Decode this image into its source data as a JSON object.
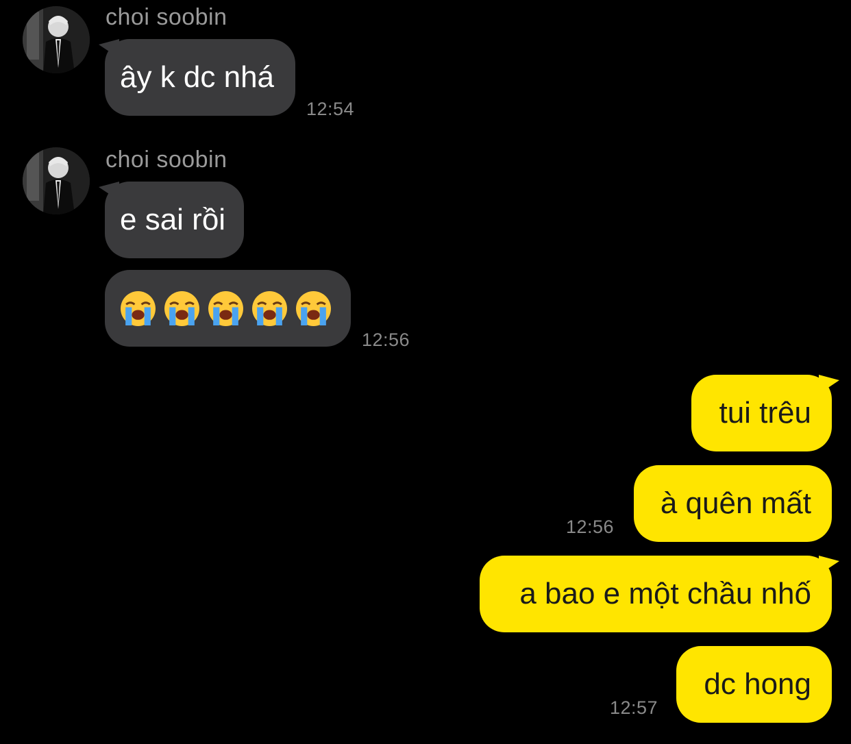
{
  "colors": {
    "background": "#000000",
    "incoming_bubble": "#3a3a3c",
    "outgoing_bubble": "#ffe500",
    "timestamp": "#8a8a8a",
    "sender_name": "#9a9a9a"
  },
  "incoming_groups": [
    {
      "sender": "choi soobin",
      "avatar_icon": "profile-photo",
      "messages": [
        "ây k dc nhá"
      ],
      "time": "12:54"
    },
    {
      "sender": "choi soobin",
      "avatar_icon": "profile-photo",
      "messages": [
        "e sai rồi",
        "😭😭😭😭😭"
      ],
      "emoji_icon": "loudly-crying-face-emoji",
      "time": "12:56"
    }
  ],
  "outgoing_groups": [
    {
      "messages": [
        "tui trêu",
        "à quên mất"
      ],
      "time": "12:56"
    },
    {
      "messages": [
        "a bao e một chầu nhố",
        "dc hong"
      ],
      "time": "12:57"
    }
  ]
}
